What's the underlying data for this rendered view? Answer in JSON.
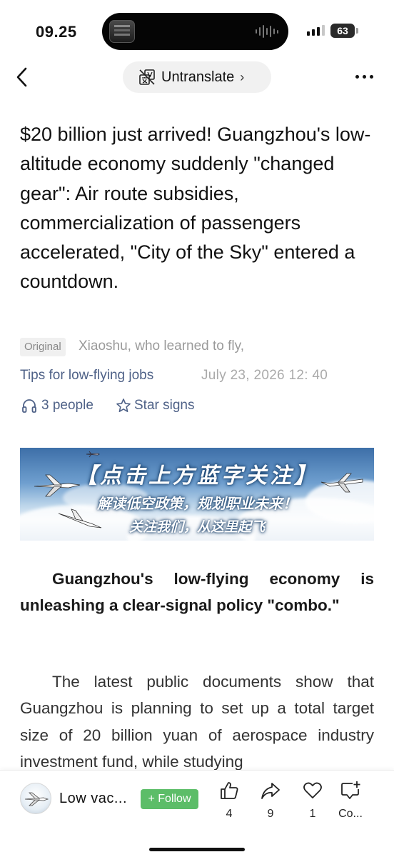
{
  "status_bar": {
    "time": "09.25",
    "battery": "63"
  },
  "nav": {
    "translate_label": "Untranslate",
    "translate_chevron": "›"
  },
  "article": {
    "title": "$20 billion just arrived! Guangzhou's low-altitude economy suddenly \"changed gear\": Air route subsidies, commercialization of passengers accelerated, \"City of the Sky\" entered a countdown.",
    "badge": "Original",
    "author": "Xiaoshu, who learned to fly,",
    "account": "Tips for low-flying jobs",
    "date": "July 23, 2026 12: 40",
    "listeners": "3 people",
    "star_label": "Star signs"
  },
  "banner": {
    "line1": "【点击上方蓝字关注】",
    "line2": "解读低空政策，规划职业未来！",
    "line3": "关注我们，从这里起飞"
  },
  "body": {
    "lead": "Guangzhou's low-flying economy is unleashing a clear-signal policy \"combo.\"",
    "p2": "The latest public documents show that Guangzhou is planning to set up a total target size of 20 billion yuan of aerospace industry investment fund, while studying"
  },
  "bottom_bar": {
    "account_name": "Low vac...",
    "follow_label": "+ Follow",
    "like_count": "4",
    "share_count": "9",
    "favorite_count": "1",
    "comment_label": "Co...",
    "follow_color": "#5cbd68"
  },
  "icons": [
    "back-arrow-icon",
    "translate-icon",
    "more-icon",
    "headphones-icon",
    "star-icon",
    "thumbs-up-icon",
    "share-icon",
    "heart-icon",
    "comment-icon"
  ],
  "colors": {
    "link": "#4e6187",
    "meta_gray": "#9a9a9a"
  }
}
